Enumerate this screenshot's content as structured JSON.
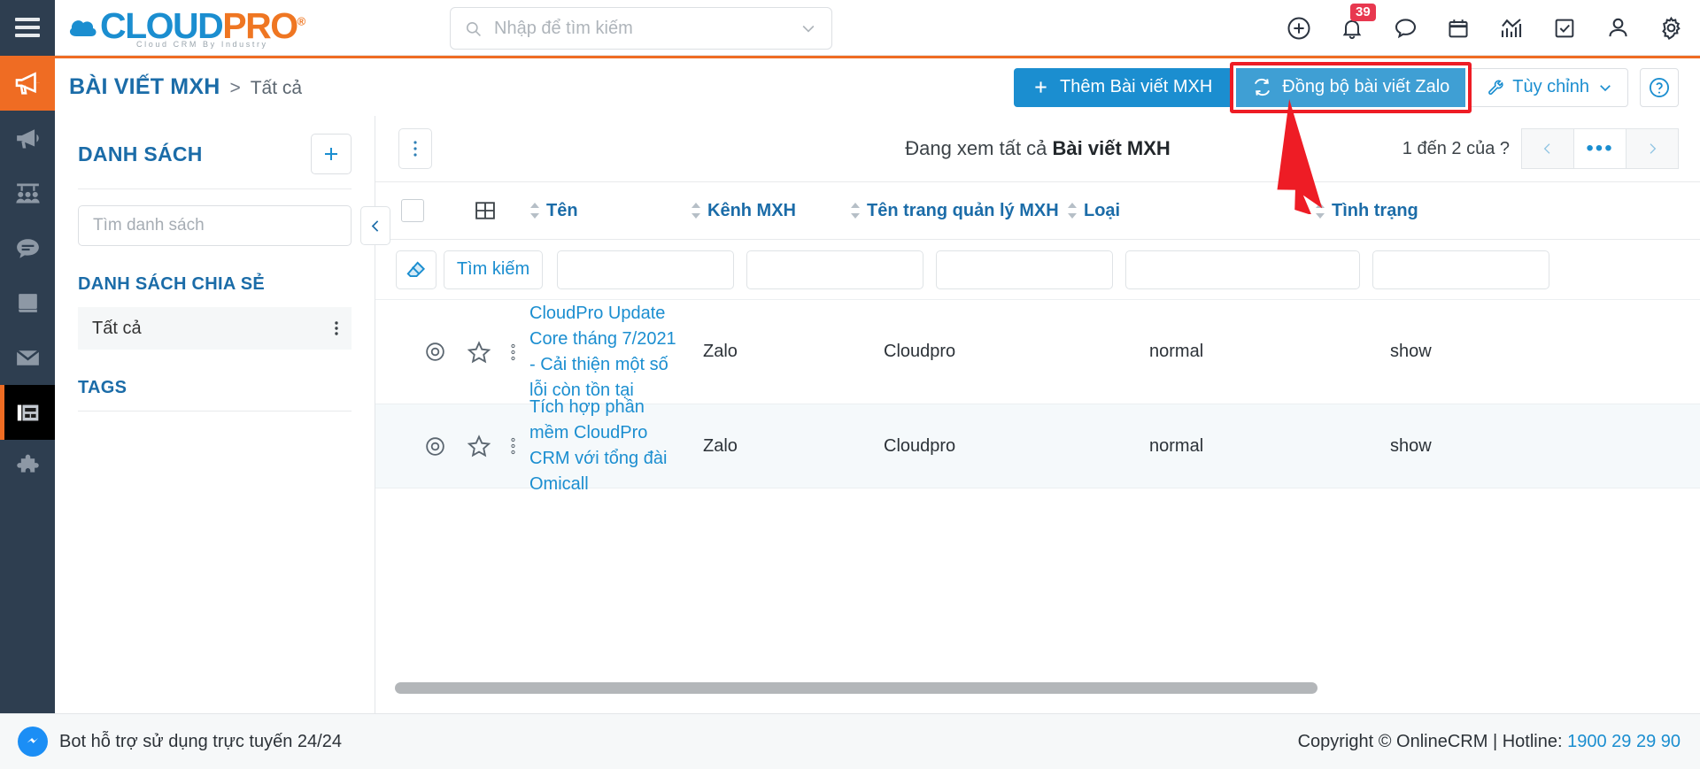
{
  "header": {
    "menu_icon": "hamburger-icon",
    "logo": {
      "part1": "CLOUD",
      "part2": "PRO",
      "registered": "®",
      "tagline": "Cloud CRM By Industry"
    },
    "search": {
      "placeholder": "Nhập để tìm kiếm",
      "value": "",
      "icon": "search-icon",
      "dropdown_icon": "chevron-down-icon"
    },
    "icons": [
      {
        "name": "add-circle-icon",
        "label": ""
      },
      {
        "name": "notification-bell-icon",
        "label": "",
        "badge": "39"
      },
      {
        "name": "chat-bubble-icon",
        "label": ""
      },
      {
        "name": "calendar-icon",
        "label": ""
      },
      {
        "name": "analytics-chart-icon",
        "label": ""
      },
      {
        "name": "task-checkbox-icon",
        "label": ""
      },
      {
        "name": "user-profile-icon",
        "label": ""
      },
      {
        "name": "settings-gear-icon",
        "label": ""
      }
    ]
  },
  "rail": {
    "items": [
      {
        "name": "campaign-megaphone-icon",
        "state": "active-orange"
      },
      {
        "name": "marketing-megaphone-icon",
        "state": "normal"
      },
      {
        "name": "audience-group-icon",
        "state": "normal"
      },
      {
        "name": "chat-message-icon",
        "state": "normal"
      },
      {
        "name": "book-library-icon",
        "state": "normal"
      },
      {
        "name": "email-envelope-icon",
        "state": "normal"
      },
      {
        "name": "social-post-icon",
        "state": "active-dark"
      },
      {
        "name": "puzzle-addon-icon",
        "state": "normal"
      }
    ]
  },
  "breadcrumb": {
    "main": "BÀI VIẾT MXH",
    "separator": ">",
    "sub": "Tất cả"
  },
  "actions": {
    "add_label": "Thêm Bài viết MXH",
    "add_icon": "plus-icon",
    "sync_label": "Đồng bộ bài viết Zalo",
    "sync_icon": "sync-refresh-icon",
    "custom_label": "Tùy chỉnh",
    "custom_icon": "wrench-icon",
    "custom_caret": "chevron-down-icon",
    "help_icon": "question-circle-icon",
    "highlight_color": "#ee1c25"
  },
  "list_panel": {
    "title": "DANH SÁCH",
    "add_icon": "plus-icon",
    "search_placeholder": "Tìm danh sách",
    "shared_title": "DANH SÁCH CHIA SẺ",
    "shared_items": [
      {
        "label": "Tất cả",
        "menu_icon": "kebab-menu-icon"
      }
    ],
    "tags_title": "TAGS"
  },
  "table": {
    "kebab_icon": "kebab-menu-icon",
    "collapse_icon": "chevron-left-icon",
    "view_title_prefix": "Đang xem tất cả ",
    "view_title_bold": "Bài viết MXH",
    "pagination": {
      "label": "1 đến 2 của  ?",
      "prev_icon": "chevron-left-icon",
      "more_label": "•••",
      "next_icon": "chevron-right-icon"
    },
    "grid_icon": "grid-layout-icon",
    "columns": [
      {
        "label": "Tên",
        "sort_icon": "sort-arrows-icon"
      },
      {
        "label": "Kênh MXH",
        "sort_icon": "sort-arrows-icon"
      },
      {
        "label": "Tên trang quản lý MXH",
        "sort_icon": "sort-arrows-icon"
      },
      {
        "label": "Loại",
        "sort_icon": "sort-arrows-icon"
      },
      {
        "label": "Tình trạng",
        "sort_icon": "sort-arrows-icon"
      }
    ],
    "filter": {
      "eraser_icon": "eraser-clear-icon",
      "search_label": "Tìm kiếm",
      "values": [
        "",
        "",
        "",
        "",
        ""
      ]
    },
    "rows": [
      {
        "eye_icon": "eye-preview-icon",
        "star_icon": "star-favorite-icon",
        "dots_icon": "kebab-menu-icon",
        "name": "CloudPro Update Core tháng 7/2021 - Cải thiện một số lỗi còn tồn tại",
        "channel": "Zalo",
        "page_name": "Cloudpro",
        "type": "normal",
        "status": "show"
      },
      {
        "eye_icon": "eye-preview-icon",
        "star_icon": "star-favorite-icon",
        "dots_icon": "kebab-menu-icon",
        "name": "Tích hợp phần mềm CloudPro CRM với tổng đài Omicall",
        "channel": "Zalo",
        "page_name": "Cloudpro",
        "type": "normal",
        "status": "show"
      }
    ]
  },
  "footer": {
    "bot_icon": "messenger-icon",
    "bot_text": "Bot hỗ trợ sử dụng trực tuyến 24/24",
    "copyright": "Copyright © OnlineCRM | Hotline: ",
    "hotline": "1900 29 29 90"
  }
}
